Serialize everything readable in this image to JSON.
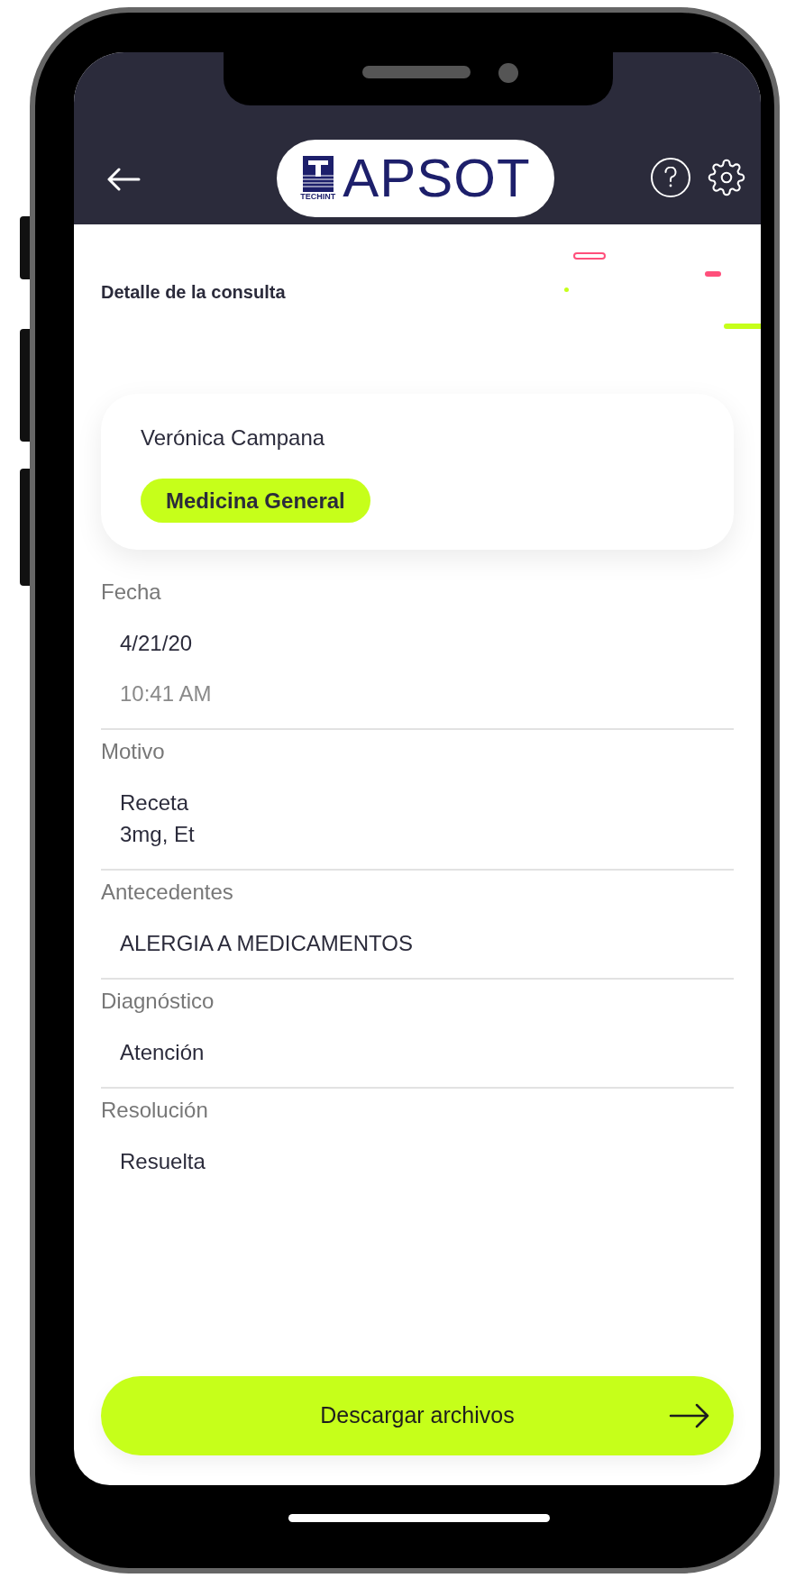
{
  "header": {
    "logo_text": "APSOT",
    "logo_subtext": "TECHINT"
  },
  "title": "Detalle de la consulta",
  "patient": {
    "name": "Verónica Campana",
    "specialty": "Medicina General"
  },
  "sections": [
    {
      "label": "Fecha",
      "value_lines": [
        "4/21/20"
      ],
      "secondary": "10:41 AM"
    },
    {
      "label": "Motivo",
      "value_lines": [
        "Receta",
        "3mg, Et"
      ]
    },
    {
      "label": "Antecedentes",
      "value_lines": [
        "ALERGIA A MEDICAMENTOS"
      ]
    },
    {
      "label": "Diagnóstico",
      "value_lines": [
        "Atención"
      ]
    },
    {
      "label": "Resolución",
      "value_lines": [
        "Resuelta"
      ]
    }
  ],
  "button": {
    "label": "Descargar archivos"
  }
}
